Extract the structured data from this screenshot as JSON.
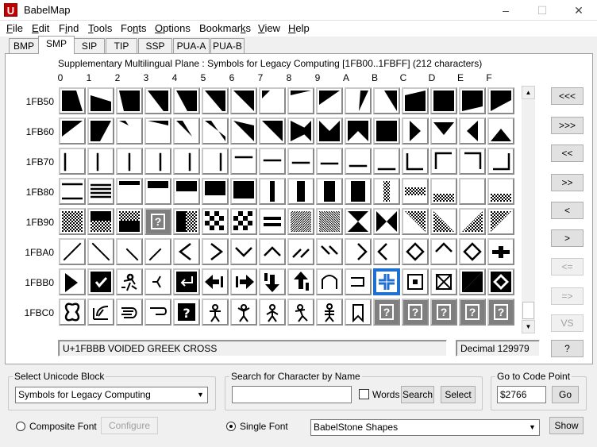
{
  "window": {
    "title": "BabelMap",
    "app_icon": "U",
    "minimize": "–",
    "maximize": "☐",
    "close": "✕"
  },
  "menu": [
    {
      "pre": "",
      "key": "F",
      "post": "ile"
    },
    {
      "pre": "",
      "key": "E",
      "post": "dit"
    },
    {
      "pre": "F",
      "key": "i",
      "post": "nd"
    },
    {
      "pre": "",
      "key": "T",
      "post": "ools"
    },
    {
      "pre": "Fo",
      "key": "n",
      "post": "ts"
    },
    {
      "pre": "",
      "key": "O",
      "post": "ptions"
    },
    {
      "pre": "Bookmar",
      "key": "k",
      "post": "s"
    },
    {
      "pre": "",
      "key": "V",
      "post": "iew"
    },
    {
      "pre": "",
      "key": "H",
      "post": "elp"
    }
  ],
  "tabs": [
    "BMP",
    "SMP",
    "SIP",
    "TIP",
    "SSP",
    "PUA-A",
    "PUA-B"
  ],
  "active_tab": 1,
  "plane_info": "Supplementary Multilingual Plane : Symbols for Legacy Computing [1FB00..1FBFF] (212 characters)",
  "col_headers": [
    "0",
    "1",
    "2",
    "3",
    "4",
    "5",
    "6",
    "7",
    "8",
    "9",
    "A",
    "B",
    "C",
    "D",
    "E",
    "F"
  ],
  "row_headers": [
    "1FB50",
    "1FB60",
    "1FB70",
    "1FB80",
    "1FB90",
    "1FBA0",
    "1FBB0",
    "1FBC0"
  ],
  "missing_glyph": "?",
  "selected_cell": {
    "row": 6,
    "col": 11
  },
  "nav_buttons": [
    {
      "label": "<<<",
      "enabled": true
    },
    {
      "label": ">>>",
      "enabled": true
    },
    {
      "label": "<<",
      "enabled": true
    },
    {
      "label": ">>",
      "enabled": true
    },
    {
      "label": "<",
      "enabled": true
    },
    {
      "label": ">",
      "enabled": true
    },
    {
      "label": "<=",
      "enabled": false
    },
    {
      "label": "=>",
      "enabled": false
    },
    {
      "label": "VS",
      "enabled": false
    }
  ],
  "status": {
    "char_name": "U+1FBBB VOIDED GREEK CROSS",
    "decimal": "Decimal 129979",
    "help": "?"
  },
  "select_block": {
    "label": "Select Unicode Block",
    "value": "Symbols for Legacy Computing"
  },
  "search": {
    "label": "Search for Character by Name",
    "value": "",
    "words_label": "Words",
    "words_checked": false,
    "search_btn": "Search",
    "select_btn": "Select"
  },
  "goto": {
    "label": "Go to Code Point",
    "value": "$2766",
    "go_btn": "Go"
  },
  "font_mode": {
    "composite_label": "Composite Font",
    "configure_btn": "Configure",
    "single_label": "Single Font",
    "selected": "single",
    "font_value": "BabelStone Shapes",
    "show_btn": "Show"
  },
  "icons": {
    "scroll_up": "▲",
    "scroll_down": "▼",
    "dropdown": "▼"
  }
}
